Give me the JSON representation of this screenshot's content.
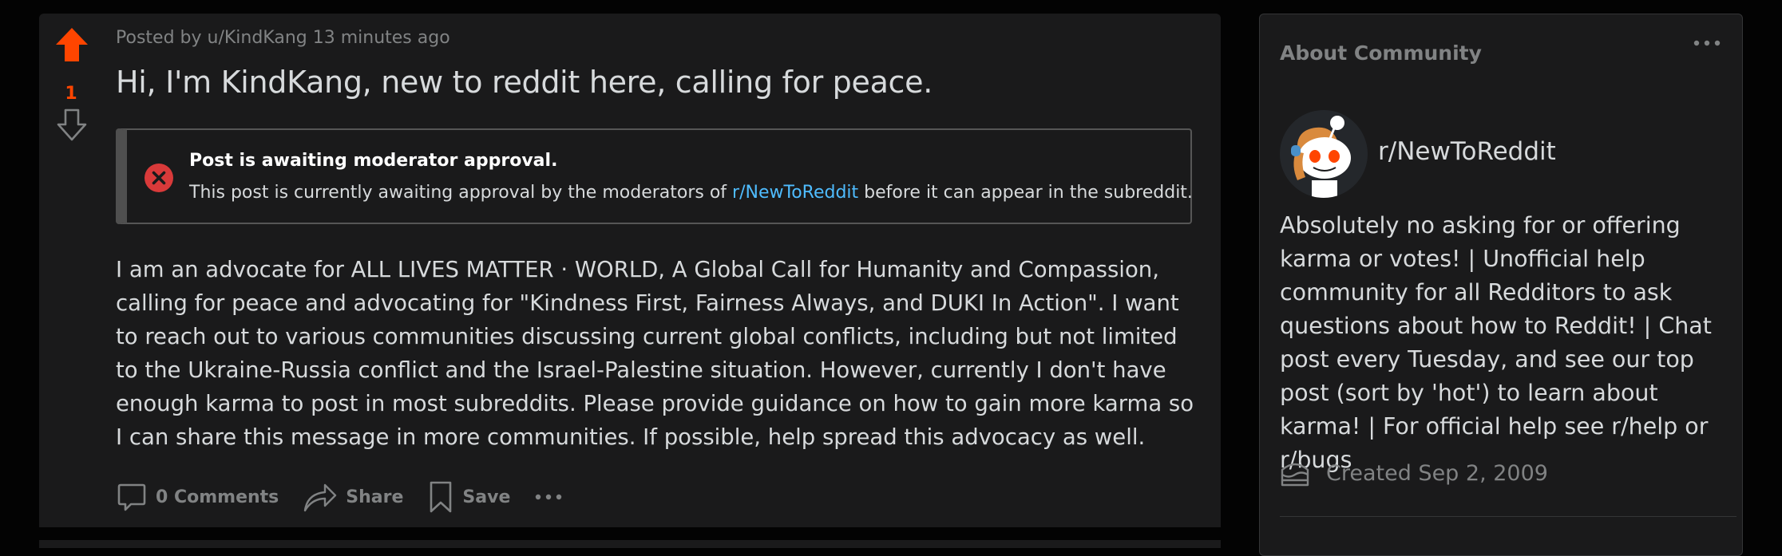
{
  "post": {
    "vote_count": "1",
    "meta": "Posted by u/KindKang 13 minutes ago",
    "title": "Hi, I'm KindKang, new to reddit here, calling for peace.",
    "mod_notice": {
      "title": "Post is awaiting moderator approval.",
      "body_before": "This post is currently awaiting approval by the moderators of ",
      "link": "r/NewToReddit",
      "body_after": " before it can appear in the subreddit."
    },
    "body": "I am an advocate for ALL LIVES MATTER · WORLD, A Global Call for Humanity and Compassion, calling for peace and advocating for \"Kindness First, Fairness Always, and DUKI In Action\". I want to reach out to various communities discussing current global conflicts, including but not limited to the Ukraine-Russia conflict and the Israel-Palestine situation. However, currently I don't have enough karma to post in most subreddits. Please provide guidance on how to gain more karma so I can share this message in more communities. If possible, help spread this advocacy as well.",
    "actions": {
      "comments": "0 Comments",
      "share": "Share",
      "save": "Save"
    },
    "colors": {
      "upvote": "#ff4500",
      "link": "#4fbcff",
      "error": "#d93a3a"
    }
  },
  "sidebar": {
    "header": "About Community",
    "name": "r/NewToReddit",
    "description": "Absolutely no asking for or offering karma or votes! | Unofficial help community for all Redditors to ask questions about how to Reddit! | Chat post every Tuesday, and see our top post (sort by 'hot') to learn about karma! | For official help see r/help or r/bugs",
    "created": "Created Sep 2, 2009"
  }
}
